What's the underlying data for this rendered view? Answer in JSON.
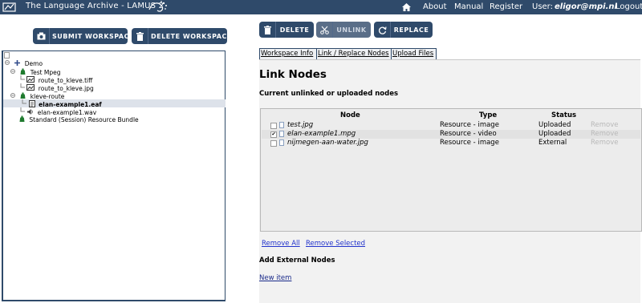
{
  "header": {
    "app_title": "The Language Archive - LAMUS 2",
    "nav": {
      "about": "About",
      "manual": "Manual",
      "register": "Register",
      "user_label": "User:",
      "user_email": "eligor@mpi.nl",
      "logout": "Logout"
    },
    "icons": [
      "logo-icon",
      "swirl-logo-icon",
      "home-icon"
    ]
  },
  "left_toolbar": {
    "submit": "SUBMIT WORKSPACE",
    "delete": "DELETE WORKSPACE"
  },
  "right_toolbar": {
    "delete": "DELETE",
    "unlink": "UNLINK",
    "replace": "REPLACE"
  },
  "tree": [
    {
      "label": "Demo",
      "icon": "plus-icon"
    },
    {
      "label": "Test Mpeg",
      "icon": "bag-icon"
    },
    {
      "label": "route_to_kleve.tiff",
      "icon": "image-file-icon"
    },
    {
      "label": "route_to_kleve.jpg",
      "icon": "image-file-icon"
    },
    {
      "label": "kleve-route",
      "icon": "bag-icon"
    },
    {
      "label": "elan-example1.eaf",
      "icon": "document-icon",
      "selected": true
    },
    {
      "label": "elan-example1.wav",
      "icon": "audio-icon"
    },
    {
      "label": "Standard (Session) Resource Bundle",
      "icon": "bag-icon"
    }
  ],
  "tabs": [
    "Workspace Info",
    "Link / Replace Nodes",
    "Upload Files"
  ],
  "main": {
    "title": "Link Nodes",
    "current_section": "Current unlinked or uploaded nodes",
    "columns": {
      "node": "Node",
      "type": "Type",
      "status": "Status"
    },
    "rows": [
      {
        "name": "test.jpg",
        "type": "Resource - image",
        "status": "Uploaded",
        "action": "Remove",
        "checked": false
      },
      {
        "name": "elan-example1.mpg",
        "type": "Resource - video",
        "status": "Uploaded",
        "action": "Remove",
        "checked": true
      },
      {
        "name": "nijmegen-aan-water.jpg",
        "type": "Resource - image",
        "status": "External",
        "action": "Remove",
        "checked": false
      }
    ],
    "remove_all": "Remove All",
    "remove_selected": "Remove Selected",
    "external_section": "Add External Nodes",
    "new_item": "New item"
  },
  "colors": {
    "primary": "#2f4a6a",
    "panel_bg": "#f2f2f2",
    "link": "#2233cc",
    "disabled_text": "#b8b8b8"
  }
}
